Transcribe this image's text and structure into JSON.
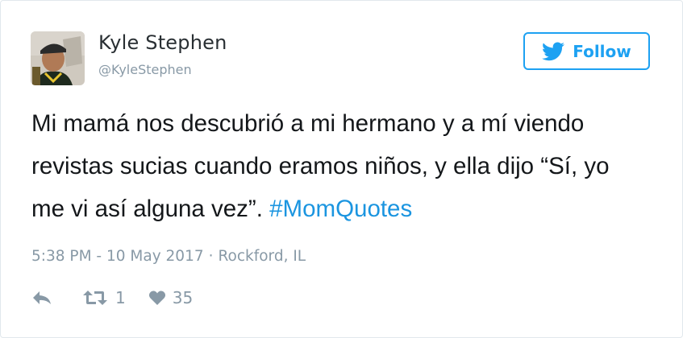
{
  "tweet": {
    "author": {
      "name": "Kyle Stephen",
      "handle": "@KyleStephen"
    },
    "follow_label": "Follow",
    "text": "Mi mamá nos descubrió a mi hermano y a mí viendo revistas sucias cuando eramos niños, y ella dijo “Sí, yo me vi así alguna vez”. ",
    "hashtag": "#MomQuotes",
    "time": "5:38 PM - 10 May 2017",
    "separator": "·",
    "location": "Rockford, IL",
    "retweets": "1",
    "likes": "35"
  },
  "colors": {
    "accent": "#1da1f2",
    "hashtag": "#1b95e0",
    "muted": "#8899a6",
    "text": "#14171a"
  },
  "icons": [
    "twitter-bird-icon",
    "reply-icon",
    "retweet-icon",
    "heart-icon"
  ]
}
